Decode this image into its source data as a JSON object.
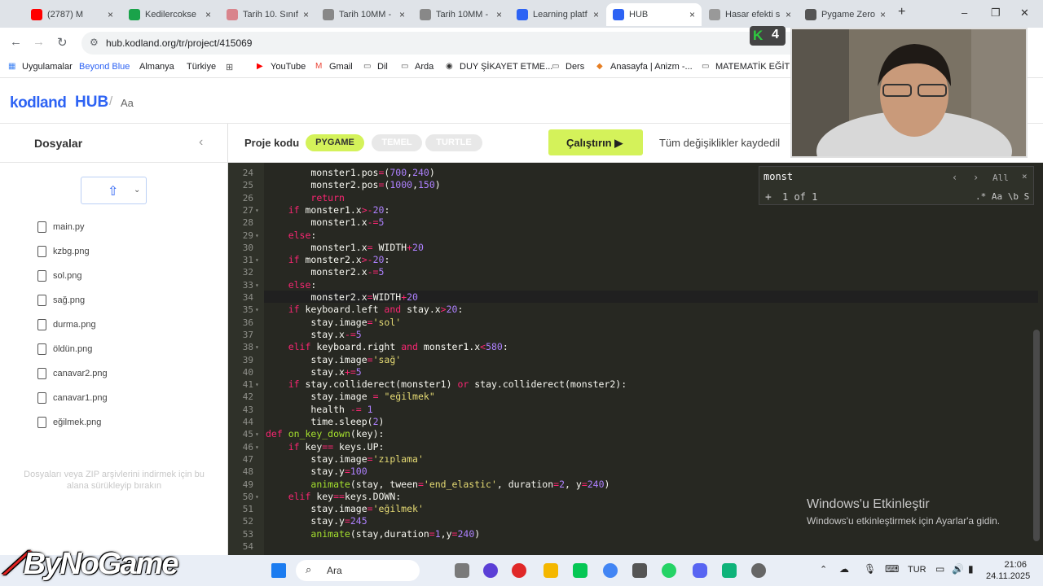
{
  "browser": {
    "tabs": [
      {
        "title": "(2787) M",
        "color": "#ff0000"
      },
      {
        "title": "Kedilercokse",
        "color": "#1aa34a"
      },
      {
        "title": "Tarih 10. Sınıf",
        "color": "#d9848c"
      },
      {
        "title": "Tarih 10MM -",
        "color": "#888888"
      },
      {
        "title": "Tarih 10MM -",
        "color": "#888888"
      },
      {
        "title": "Learning platf",
        "color": "#2d63f4"
      },
      {
        "title": "HUB",
        "color": "#2d63f4"
      },
      {
        "title": "Hasar efekti s",
        "color": "#999999"
      },
      {
        "title": "Pygame Zero",
        "color": "#555555"
      }
    ],
    "url": "hub.kodland.org/tr/project/415069",
    "bookmarks": [
      "Uygulamalar",
      "Beyond Blue",
      "Almanya",
      "Türkiye",
      "YouTube",
      "Gmail",
      "Dil",
      "Arda",
      "DUY ŞİKAYET ETME...",
      "Ders",
      "Anasayfa | Anizm -...",
      "MATEMATİK EĞİTİ..."
    ]
  },
  "app": {
    "logo": "kodland",
    "hub": "HUB",
    "breadcrumb": "Aa",
    "sidebar_title": "Dosyalar",
    "files": [
      "main.py",
      "kzbg.png",
      "sol.png",
      "sağ.png",
      "durma.png",
      "öldün.png",
      "canavar2.png",
      "canavar1.png",
      "eğilmek.png"
    ],
    "drop_hint": "Dosyaları veya ZIP arşivlerini indirmek için bu alana sürükleyip bırakın",
    "project_label": "Proje kodu",
    "modes": [
      "PYGAME",
      "TEMEL",
      "TURTLE"
    ],
    "run_label": "Çalıştırın",
    "saved_status": "Tüm değişiklikler kaydedil"
  },
  "editor": {
    "search_query": "monst",
    "search_count": "1 of 1",
    "search_all": "All",
    "search_options": ".* Aa \\b S",
    "lines": [
      {
        "n": 24,
        "text": "        monster1.pos=(700,240)"
      },
      {
        "n": 25,
        "text": "        monster2.pos=(1000,150)"
      },
      {
        "n": 26,
        "text": "        return"
      },
      {
        "n": 27,
        "text": "    if monster1.x>-20:"
      },
      {
        "n": 28,
        "text": "        monster1.x-=5"
      },
      {
        "n": 29,
        "text": "    else:"
      },
      {
        "n": 30,
        "text": "        monster1.x= WIDTH+20"
      },
      {
        "n": 31,
        "text": "    if monster2.x>-20:"
      },
      {
        "n": 32,
        "text": "        monster2.x-=5"
      },
      {
        "n": 33,
        "text": "    else:"
      },
      {
        "n": 34,
        "text": "        monster2.x=WIDTH+20"
      },
      {
        "n": 35,
        "text": "    if keyboard.left and stay.x>20:"
      },
      {
        "n": 36,
        "text": "        stay.image='sol'"
      },
      {
        "n": 37,
        "text": "        stay.x-=5"
      },
      {
        "n": 38,
        "text": "    elif keyboard.right and monster1.x<580:"
      },
      {
        "n": 39,
        "text": "        stay.image='sağ'"
      },
      {
        "n": 40,
        "text": "        stay.x+=5"
      },
      {
        "n": 41,
        "text": "    if stay.colliderect(monster1) or stay.colliderect(monster2):"
      },
      {
        "n": 42,
        "text": "        stay.image = \"eğilmek\""
      },
      {
        "n": 43,
        "text": "        health -= 1"
      },
      {
        "n": 44,
        "text": "        time.sleep(2)"
      },
      {
        "n": 45,
        "text": "def on_key_down(key):"
      },
      {
        "n": 46,
        "text": "    if key== keys.UP:"
      },
      {
        "n": 47,
        "text": "        stay.image='zıplama'"
      },
      {
        "n": 48,
        "text": "        stay.y=100"
      },
      {
        "n": 49,
        "text": "        animate(stay, tween='end_elastic', duration=2, y=240)"
      },
      {
        "n": 50,
        "text": "    elif key==keys.DOWN:"
      },
      {
        "n": 51,
        "text": "        stay.image='eğilmek'"
      },
      {
        "n": 52,
        "text": "        stay.y=245"
      },
      {
        "n": 53,
        "text": "        animate(stay,duration=1,y=240)"
      },
      {
        "n": 54,
        "text": ""
      }
    ]
  },
  "overlay": {
    "windows_title": "Windows'u Etkinleştir",
    "windows_sub": "Windows'u etkinleştirmek için Ayarlar'a gidin.",
    "watermark": "ByNoGame",
    "kodland_badge": "4"
  },
  "taskbar": {
    "search": "Ara",
    "lang": "TUR",
    "time": "21:06",
    "date": "24.11.2025"
  }
}
